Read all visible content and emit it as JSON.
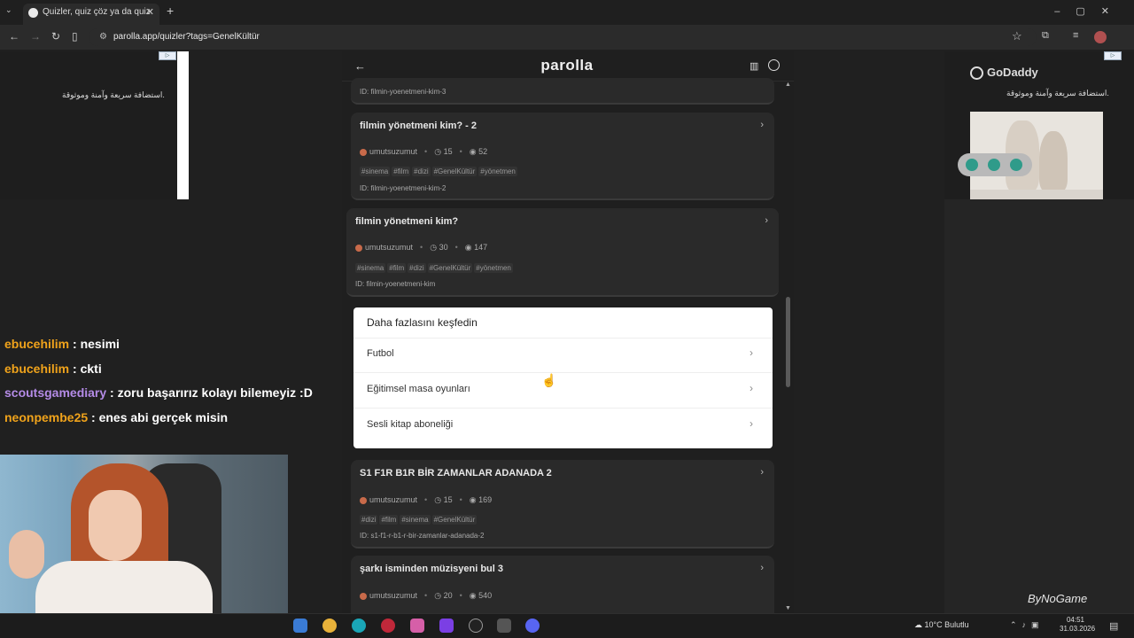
{
  "browser": {
    "tab_title": "Quizler, quiz çöz ya da quiz olu",
    "new_tab": "+",
    "url": "parolla.app/quizler?tags=GenelKültür"
  },
  "ads": {
    "left_text": "استضافة سريعة وآمنة وموثوقة.",
    "brand": "GoDaddy",
    "right_text": "استضافة سريعة وآمنة وموثوقة."
  },
  "app": {
    "brand": "parolla",
    "top_card_id": "ID: filmin-yoenetmeni-kim-3",
    "cards": [
      {
        "title": "filmin yönetmeni kim? - 2",
        "author": "umutsuzumut",
        "time": "15",
        "views": "52",
        "tags": [
          "#sinema",
          "#film",
          "#dizi",
          "#GenelKültür",
          "#yönetmen"
        ],
        "id": "ID: filmin-yoenetmeni-kim-2"
      },
      {
        "title": "filmin yönetmeni kim?",
        "author": "umutsuzumut",
        "time": "30",
        "views": "147",
        "tags": [
          "#sinema",
          "#film",
          "#dizi",
          "#GenelKültür",
          "#yönetmen"
        ],
        "id": "ID: filmin-yoenetmeni-kim"
      },
      {
        "title": "S1 F1R B1R BİR ZAMANLAR ADANADA 2",
        "author": "umutsuzumut",
        "time": "15",
        "views": "169",
        "tags": [
          "#dizi",
          "#film",
          "#sinema",
          "#GenelKültür"
        ],
        "id": "ID: s1-f1-r-b1-r-bir-zamanlar-adanada-2"
      },
      {
        "title": "şarkı isminden müzisyeni bul 3",
        "author": "umutsuzumut",
        "time": "20",
        "views": "540"
      }
    ],
    "explore": {
      "heading": "Daha fazlasını keşfedin",
      "items": [
        "Futbol",
        "Eğitimsel masa oyunları",
        "Sesli kitap aboneliği"
      ]
    }
  },
  "chat": [
    {
      "user": "ebucehilim",
      "msg": " : nesimi",
      "color": "#f0a31b"
    },
    {
      "user": "ebucehilim",
      "msg": " : ckti",
      "color": "#f0a31b"
    },
    {
      "user": "scoutsgamediary",
      "msg": " : zoru başarırız kolayı bilemeyiz :D",
      "color": "#b48be6"
    },
    {
      "user": "neonpembe25",
      "msg": " : enes abi gerçek misin",
      "color": "#f0a31b"
    }
  ],
  "overlay": {
    "watermark": "ByNoGame"
  },
  "taskbar": {
    "weather": "10°C Bulutlu",
    "time": "04:51",
    "date": "31.03.2026"
  }
}
